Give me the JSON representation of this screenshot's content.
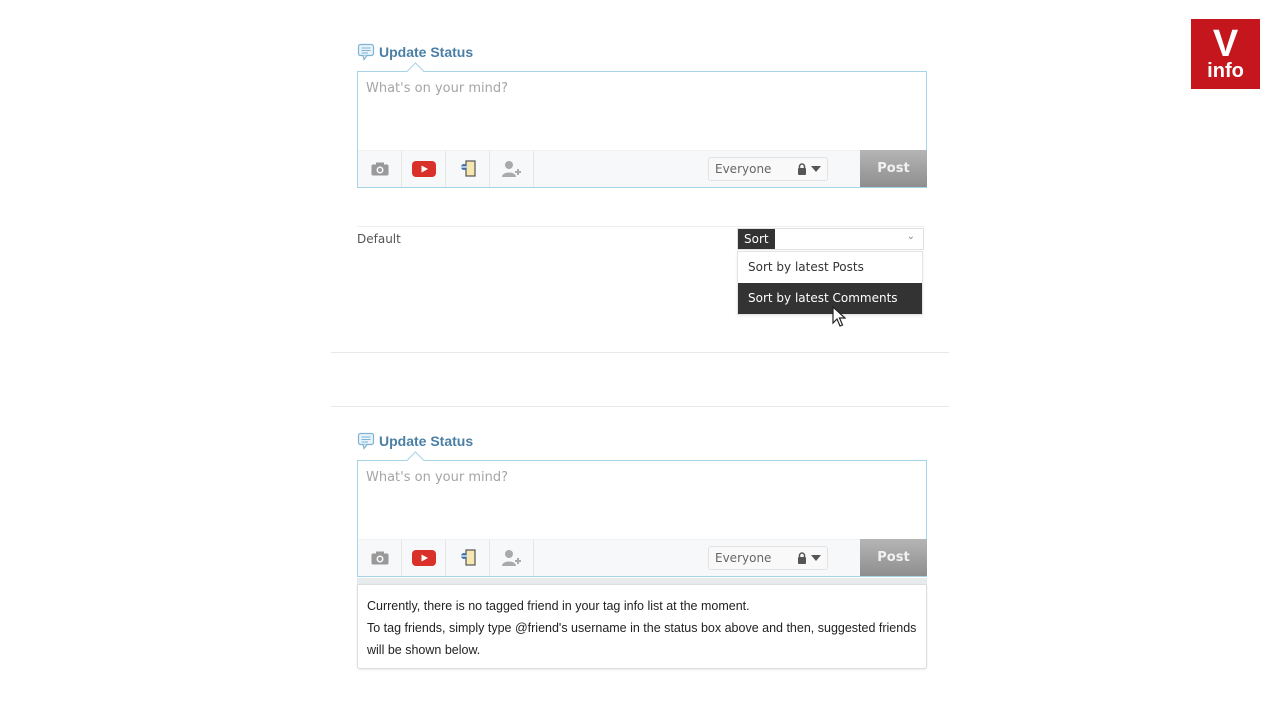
{
  "logo": {
    "letter": "V",
    "text": "info",
    "color": "#c4161c"
  },
  "status_widgets": [
    {
      "heading": "Update Status",
      "placeholder": "What's on your mind?",
      "tools": [
        "camera-icon",
        "youtube-icon",
        "attach-file-icon",
        "tag-friend-icon"
      ],
      "privacy": "Everyone",
      "post_label": "Post"
    },
    {
      "heading": "Update Status",
      "placeholder": "What's on your mind?",
      "tools": [
        "camera-icon",
        "youtube-icon",
        "attach-file-icon",
        "tag-friend-icon"
      ],
      "privacy": "Everyone",
      "post_label": "Post"
    }
  ],
  "sort": {
    "default_label": "Default",
    "select_label": "Sort",
    "options": [
      {
        "label": "Sort by latest Posts",
        "active": false
      },
      {
        "label": "Sort by latest Comments",
        "active": true
      }
    ]
  },
  "tag_info": {
    "line1": "Currently, there is no tagged friend in your tag info list at the moment.",
    "line2": "To tag friends, simply type @friend's username in the status box above and then, suggested friends will be shown below."
  },
  "colors": {
    "accent": "#4a7fa6",
    "border": "#a6d3e6",
    "youtube": "#d9302a",
    "dark": "#333333"
  }
}
